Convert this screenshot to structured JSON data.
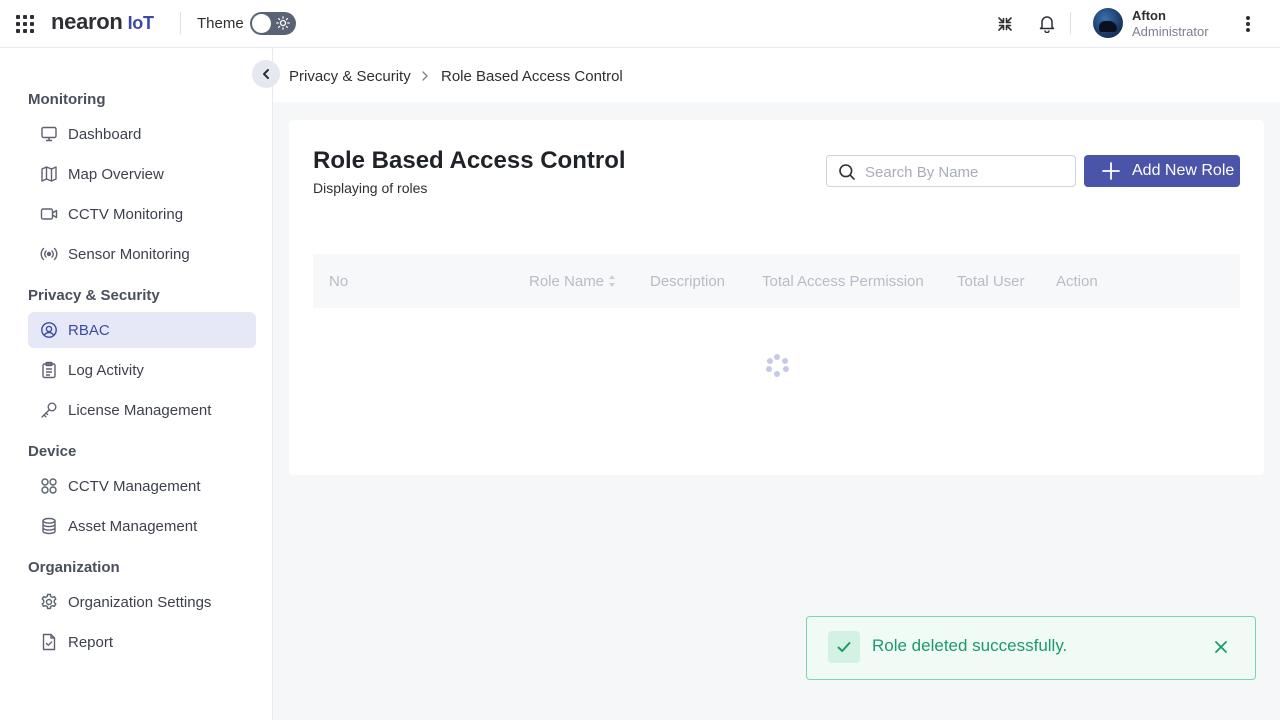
{
  "header": {
    "logo_brand": "nearon",
    "logo_suffix": "IoT",
    "theme_label": "Theme",
    "user_name": "Afton",
    "user_role": "Administrator"
  },
  "sidebar": {
    "sections": [
      {
        "title": "Monitoring"
      },
      {
        "title": "Privacy & Security"
      },
      {
        "title": "Device"
      },
      {
        "title": "Organization"
      }
    ],
    "items": [
      {
        "label": "Dashboard",
        "icon": "monitor-icon"
      },
      {
        "label": "Map Overview",
        "icon": "map-icon"
      },
      {
        "label": "CCTV Monitoring",
        "icon": "video-icon"
      },
      {
        "label": "Sensor Monitoring",
        "icon": "broadcast-icon"
      },
      {
        "label": "RBAC",
        "icon": "user-circle-icon",
        "active": true
      },
      {
        "label": "Log Activity",
        "icon": "clipboard-icon"
      },
      {
        "label": "License Management",
        "icon": "key-icon"
      },
      {
        "label": "CCTV Management",
        "icon": "grid-icon"
      },
      {
        "label": "Asset Management",
        "icon": "database-icon"
      },
      {
        "label": "Organization Settings",
        "icon": "gear-icon"
      },
      {
        "label": "Report",
        "icon": "document-icon"
      }
    ]
  },
  "breadcrumb": {
    "parent": "Privacy & Security",
    "current": "Role Based Access Control"
  },
  "main": {
    "title": "Role Based Access Control",
    "subtitle": "Displaying of roles",
    "search_placeholder": "Search By Name",
    "add_button_label": "Add New Role",
    "table_columns": [
      "No",
      "Role Name",
      "Description",
      "Total Access Permission",
      "Total User",
      "Action"
    ],
    "loading": true
  },
  "toast": {
    "message": "Role deleted successfully.",
    "type": "success",
    "color": "#1c9a68"
  },
  "colors": {
    "accent": "#4a54a8",
    "active_bg": "#e6e8f8",
    "success": "#1c9a68"
  }
}
